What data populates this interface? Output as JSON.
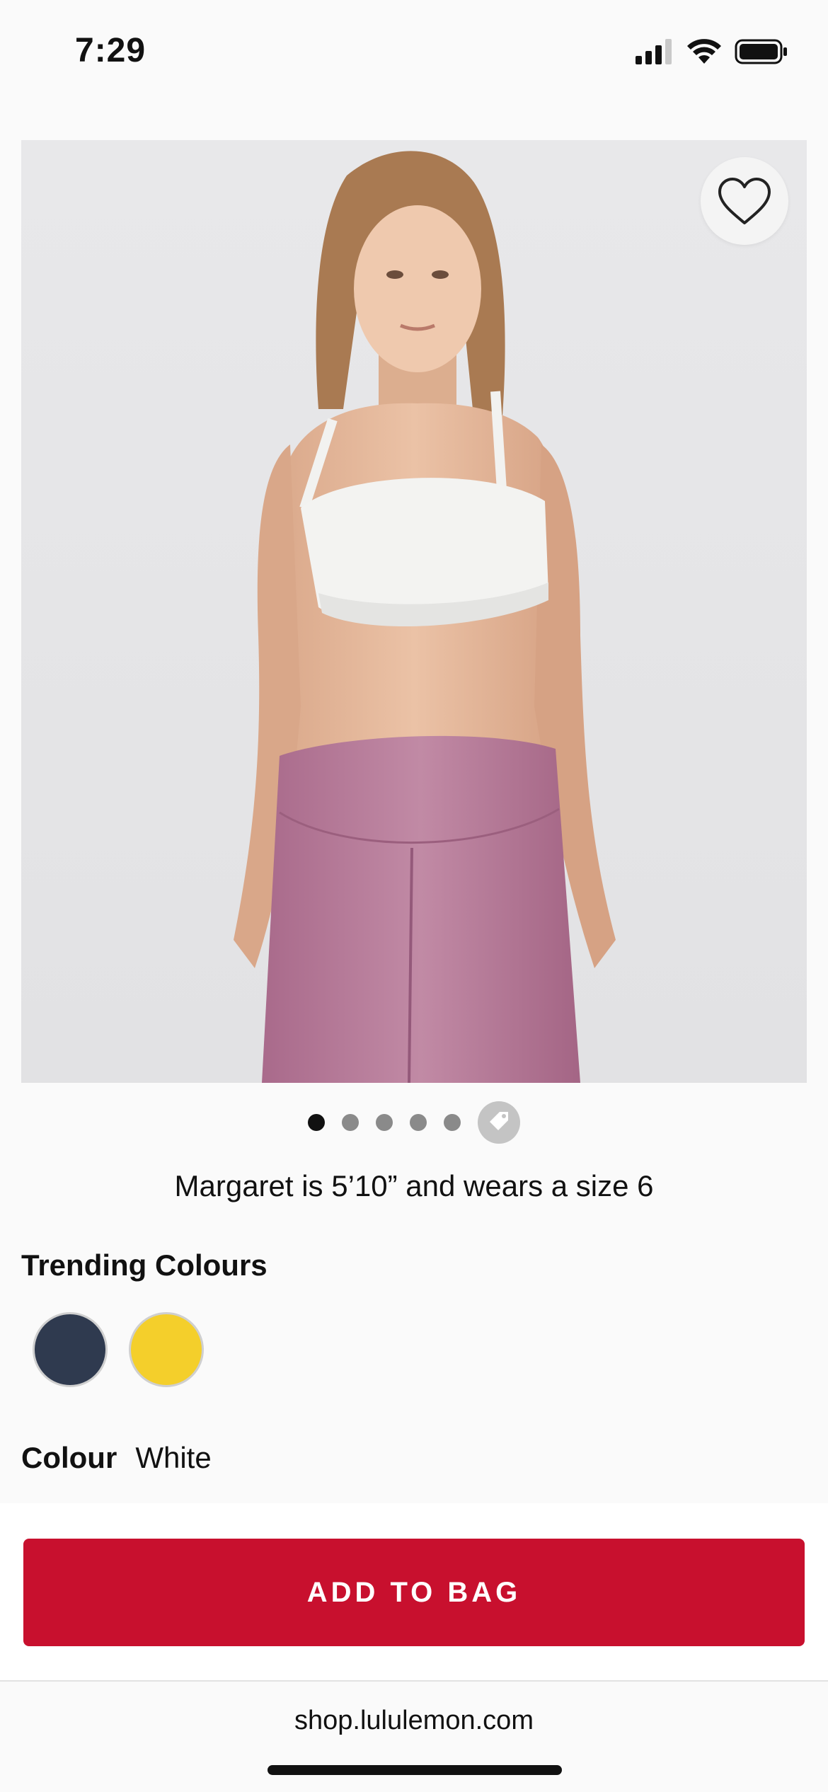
{
  "status_bar": {
    "time": "7:29",
    "signal_icon": "cellular-signal-icon",
    "wifi_icon": "wifi-icon",
    "battery_icon": "battery-icon"
  },
  "product_image": {
    "wishlist_icon": "heart-icon"
  },
  "gallery": {
    "dot_count": 5,
    "active_index": 0,
    "tag_icon": "price-tag-icon"
  },
  "model_info": "Margaret is 5’10” and wears a size 6",
  "trending": {
    "title": "Trending Colours",
    "swatches": [
      {
        "color": "#2f3a4f"
      },
      {
        "color": "#f4cf2b"
      }
    ]
  },
  "colour": {
    "label": "Colour",
    "value": "White"
  },
  "cta": {
    "label": "ADD TO BAG",
    "color": "#c8102e"
  },
  "browser": {
    "url": "shop.lululemon.com"
  }
}
